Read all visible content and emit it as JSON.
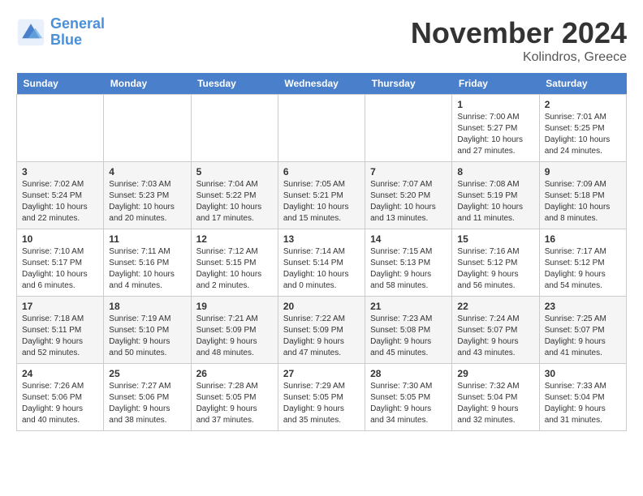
{
  "header": {
    "logo_line1": "General",
    "logo_line2": "Blue",
    "month_title": "November 2024",
    "subtitle": "Kolindros, Greece"
  },
  "days_of_week": [
    "Sunday",
    "Monday",
    "Tuesday",
    "Wednesday",
    "Thursday",
    "Friday",
    "Saturday"
  ],
  "weeks": [
    [
      {
        "num": "",
        "info": ""
      },
      {
        "num": "",
        "info": ""
      },
      {
        "num": "",
        "info": ""
      },
      {
        "num": "",
        "info": ""
      },
      {
        "num": "",
        "info": ""
      },
      {
        "num": "1",
        "info": "Sunrise: 7:00 AM\nSunset: 5:27 PM\nDaylight: 10 hours and 27 minutes."
      },
      {
        "num": "2",
        "info": "Sunrise: 7:01 AM\nSunset: 5:25 PM\nDaylight: 10 hours and 24 minutes."
      }
    ],
    [
      {
        "num": "3",
        "info": "Sunrise: 7:02 AM\nSunset: 5:24 PM\nDaylight: 10 hours and 22 minutes."
      },
      {
        "num": "4",
        "info": "Sunrise: 7:03 AM\nSunset: 5:23 PM\nDaylight: 10 hours and 20 minutes."
      },
      {
        "num": "5",
        "info": "Sunrise: 7:04 AM\nSunset: 5:22 PM\nDaylight: 10 hours and 17 minutes."
      },
      {
        "num": "6",
        "info": "Sunrise: 7:05 AM\nSunset: 5:21 PM\nDaylight: 10 hours and 15 minutes."
      },
      {
        "num": "7",
        "info": "Sunrise: 7:07 AM\nSunset: 5:20 PM\nDaylight: 10 hours and 13 minutes."
      },
      {
        "num": "8",
        "info": "Sunrise: 7:08 AM\nSunset: 5:19 PM\nDaylight: 10 hours and 11 minutes."
      },
      {
        "num": "9",
        "info": "Sunrise: 7:09 AM\nSunset: 5:18 PM\nDaylight: 10 hours and 8 minutes."
      }
    ],
    [
      {
        "num": "10",
        "info": "Sunrise: 7:10 AM\nSunset: 5:17 PM\nDaylight: 10 hours and 6 minutes."
      },
      {
        "num": "11",
        "info": "Sunrise: 7:11 AM\nSunset: 5:16 PM\nDaylight: 10 hours and 4 minutes."
      },
      {
        "num": "12",
        "info": "Sunrise: 7:12 AM\nSunset: 5:15 PM\nDaylight: 10 hours and 2 minutes."
      },
      {
        "num": "13",
        "info": "Sunrise: 7:14 AM\nSunset: 5:14 PM\nDaylight: 10 hours and 0 minutes."
      },
      {
        "num": "14",
        "info": "Sunrise: 7:15 AM\nSunset: 5:13 PM\nDaylight: 9 hours and 58 minutes."
      },
      {
        "num": "15",
        "info": "Sunrise: 7:16 AM\nSunset: 5:12 PM\nDaylight: 9 hours and 56 minutes."
      },
      {
        "num": "16",
        "info": "Sunrise: 7:17 AM\nSunset: 5:12 PM\nDaylight: 9 hours and 54 minutes."
      }
    ],
    [
      {
        "num": "17",
        "info": "Sunrise: 7:18 AM\nSunset: 5:11 PM\nDaylight: 9 hours and 52 minutes."
      },
      {
        "num": "18",
        "info": "Sunrise: 7:19 AM\nSunset: 5:10 PM\nDaylight: 9 hours and 50 minutes."
      },
      {
        "num": "19",
        "info": "Sunrise: 7:21 AM\nSunset: 5:09 PM\nDaylight: 9 hours and 48 minutes."
      },
      {
        "num": "20",
        "info": "Sunrise: 7:22 AM\nSunset: 5:09 PM\nDaylight: 9 hours and 47 minutes."
      },
      {
        "num": "21",
        "info": "Sunrise: 7:23 AM\nSunset: 5:08 PM\nDaylight: 9 hours and 45 minutes."
      },
      {
        "num": "22",
        "info": "Sunrise: 7:24 AM\nSunset: 5:07 PM\nDaylight: 9 hours and 43 minutes."
      },
      {
        "num": "23",
        "info": "Sunrise: 7:25 AM\nSunset: 5:07 PM\nDaylight: 9 hours and 41 minutes."
      }
    ],
    [
      {
        "num": "24",
        "info": "Sunrise: 7:26 AM\nSunset: 5:06 PM\nDaylight: 9 hours and 40 minutes."
      },
      {
        "num": "25",
        "info": "Sunrise: 7:27 AM\nSunset: 5:06 PM\nDaylight: 9 hours and 38 minutes."
      },
      {
        "num": "26",
        "info": "Sunrise: 7:28 AM\nSunset: 5:05 PM\nDaylight: 9 hours and 37 minutes."
      },
      {
        "num": "27",
        "info": "Sunrise: 7:29 AM\nSunset: 5:05 PM\nDaylight: 9 hours and 35 minutes."
      },
      {
        "num": "28",
        "info": "Sunrise: 7:30 AM\nSunset: 5:05 PM\nDaylight: 9 hours and 34 minutes."
      },
      {
        "num": "29",
        "info": "Sunrise: 7:32 AM\nSunset: 5:04 PM\nDaylight: 9 hours and 32 minutes."
      },
      {
        "num": "30",
        "info": "Sunrise: 7:33 AM\nSunset: 5:04 PM\nDaylight: 9 hours and 31 minutes."
      }
    ]
  ]
}
